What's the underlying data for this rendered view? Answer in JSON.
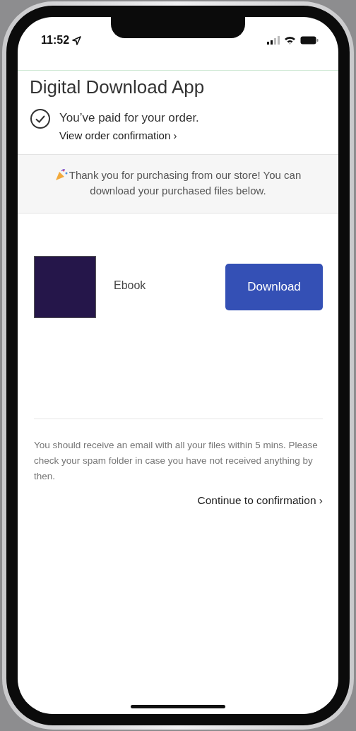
{
  "status_bar": {
    "time": "11:52"
  },
  "header": {
    "title": "Digital Download App"
  },
  "payment": {
    "message": "You’ve paid for your order.",
    "link": "View order confirmation ›"
  },
  "banner": {
    "text": "Thank you for purchasing from our store! You can download your purchased files below."
  },
  "products": [
    {
      "name": "Ebook",
      "button": "Download"
    }
  ],
  "note": "You should receive an email with all your files within 5 mins. Please check your spam folder in case you have not received anything by then.",
  "continue_link": "Continue to confirmation ›"
}
